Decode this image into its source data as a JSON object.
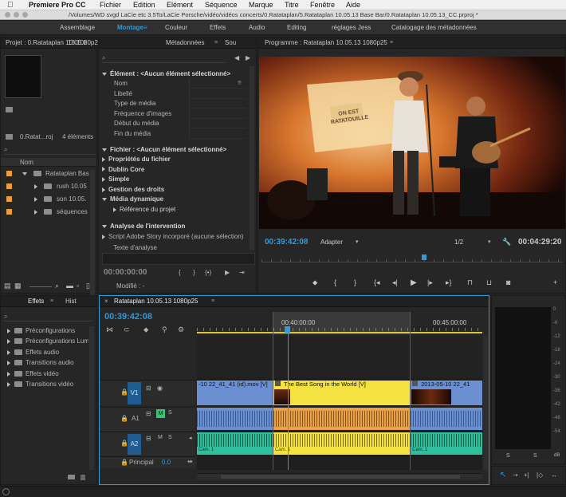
{
  "menubar": {
    "app": "Premiere Pro CC",
    "items": [
      "Fichier",
      "Edition",
      "Elément",
      "Séquence",
      "Marque",
      "Titre",
      "Fenêtre",
      "Aide"
    ]
  },
  "titlebar": {
    "path": "/Volumes/WD svgd LaCie etc 3.5To/LaCie Porsche/vidéo/vidéos concerts/0.Ratataplan/5.Ratataplan 10.05.13 Base Bar/0.Ratataplan 10.05.13_CC.prproj *"
  },
  "workspaces": [
    "Assemblage",
    "Montage",
    "Couleur",
    "Effets",
    "Audio",
    "Editing",
    "réglages Jess",
    "Catalogage des métadonnées"
  ],
  "project": {
    "tab1": "Projet : 0.Ratataplan 10.05.1",
    "tab2": "13 1080p25",
    "project_name": "0.Ratat...roj",
    "count": "4 éléments",
    "col_name": "Nom",
    "items": [
      {
        "label": "Ratataplan Bas",
        "type": "sequence",
        "expanded": true
      },
      {
        "label": "rush 10.05",
        "type": "folder"
      },
      {
        "label": "son 10.05.",
        "type": "folder"
      },
      {
        "label": "séquences",
        "type": "folder"
      }
    ]
  },
  "metadata": {
    "tab": "Métadonnées",
    "tab2": "Sou",
    "element_header": "Élément : <Aucun élément sélectionné>",
    "element_fields": [
      "Nom",
      "Libellé",
      "Type de média",
      "Fréquence d'images",
      "Début du média",
      "Fin du média"
    ],
    "file_header": "Fichier : <Aucun élément sélectionné>",
    "file_items": [
      {
        "label": "Propriétés du fichier",
        "open": false
      },
      {
        "label": "Dublin Core",
        "open": false
      },
      {
        "label": "Simple",
        "open": false
      },
      {
        "label": "Gestion des droits",
        "open": false
      },
      {
        "label": "Média dynamique",
        "open": true
      },
      {
        "label": "Référence du projet",
        "open": false,
        "indent": true
      }
    ],
    "analysis_header": "Analyse de l'intervention",
    "analysis_items": [
      "Script Adobe Story incorporé (aucune sélection)",
      "Texte d'analyse"
    ],
    "timecode": "00:00:00:00",
    "modified": "Modifié : -"
  },
  "program": {
    "tab": "Programme : Ratataplan 10.05.13 1080p25",
    "timecode": "00:39:42:08",
    "fit": "Adapter",
    "resolution": "1/2",
    "duration": "00:04:29:20",
    "playhead_fraction": 0.54,
    "sign_text": "ON EST RATATOUILLE"
  },
  "effects": {
    "tabs": [
      "Effets",
      "Hist"
    ],
    "items": [
      "Préconfigurations",
      "Préconfigurations Lum",
      "Effets audio",
      "Transitions audio",
      "Effets vidéo",
      "Transitions vidéo"
    ]
  },
  "timeline": {
    "tab": "Ratataplan 10.05.13 1080p25",
    "timecode": "00:39:42:08",
    "ruler": [
      "00:40:00:00",
      "00:45:00:00"
    ],
    "tracks": [
      "V1",
      "A1",
      "A2",
      "Principal"
    ],
    "master_value": "0.0",
    "clips": {
      "v_left": "-10 22_41_41 (id).mov [V]",
      "v_mid": "The Best Song in the World [V]",
      "v_right": "2013-05-10 22_41",
      "cam_left": "Cam. 1",
      "cam_mid": "Cam. 1",
      "cam_right": "Cam. 1"
    }
  },
  "meter": {
    "labels": [
      "S",
      "S"
    ],
    "db": "dB",
    "scale": [
      "0",
      "-6",
      "-12",
      "-18",
      "-24",
      "-30",
      "-36",
      "-42",
      "-48",
      "-54"
    ]
  },
  "colors": {
    "accent": "#2e9bdc",
    "clip_video": "#6b8fd0",
    "clip_yellow": "#f3e240",
    "clip_teal": "#2fbf9c",
    "timecode": "#2e9bdc"
  }
}
